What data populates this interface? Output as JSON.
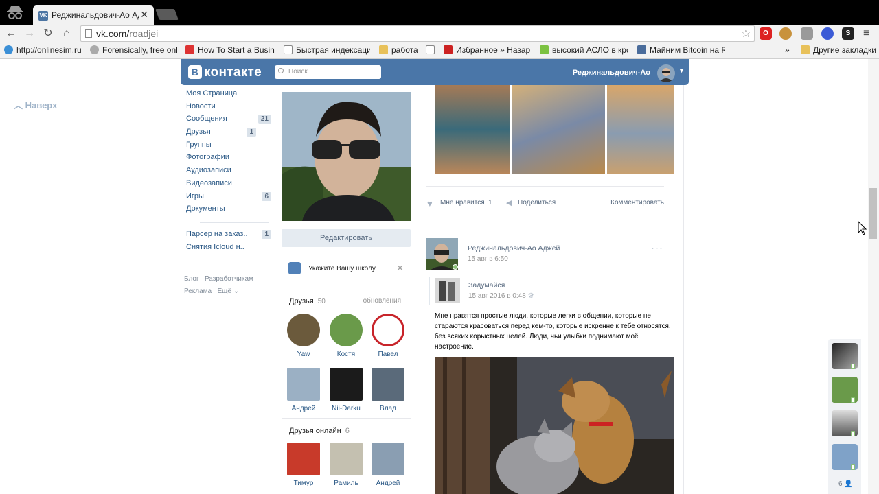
{
  "browser": {
    "tab_title": "Реджинальдович-Ао Ад",
    "tab_close": "✕",
    "url_domain": "vk.com/",
    "url_path": "roadjei",
    "bookmarks": [
      {
        "label": "http://onlinesim.ru",
        "icon": "onlinesim-icon"
      },
      {
        "label": "Forensically, free onlir",
        "icon": "magnifier-icon"
      },
      {
        "label": "How To Start a Busine",
        "icon": "ship-icon"
      },
      {
        "label": "Быстрая индексация",
        "icon": "page-icon"
      },
      {
        "label": "работа",
        "icon": "folder-icon"
      },
      {
        "label": "",
        "icon": "page-icon"
      },
      {
        "label": "Избранное » Назар Т",
        "icon": "flag-icon"
      },
      {
        "label": "высокий АСЛО в крс",
        "icon": "p-icon"
      },
      {
        "label": "Майним Bitcoin на Rt",
        "icon": "h-icon"
      }
    ],
    "bookmarks_more": "»",
    "other_bookmarks": "Другие закладки"
  },
  "vk": {
    "logo_text": "контакте",
    "logo_letter": "В",
    "search_placeholder": "Поиск",
    "header_user": "Реджинальдович-Ао",
    "back_to_top": "Наверх",
    "nav": [
      {
        "label": "Моя Страница",
        "count": ""
      },
      {
        "label": "Новости",
        "count": ""
      },
      {
        "label": "Сообщения",
        "count": "21"
      },
      {
        "label": "Друзья",
        "count": "1"
      },
      {
        "label": "Группы",
        "count": ""
      },
      {
        "label": "Фотографии",
        "count": ""
      },
      {
        "label": "Аудиозаписи",
        "count": ""
      },
      {
        "label": "Видеозаписи",
        "count": ""
      },
      {
        "label": "Игры",
        "count": "6"
      },
      {
        "label": "Документы",
        "count": ""
      }
    ],
    "nav_extra": [
      {
        "label": "Парсер на заказ..",
        "count": "1"
      },
      {
        "label": "Снятия Icloud н..",
        "count": ""
      }
    ],
    "footer": {
      "blog": "Блог",
      "dev": "Разработчикам",
      "ads": "Реклама",
      "more": "Ещё"
    },
    "edit_button": "Редактировать",
    "school_prompt": "Укажите Вашу школу",
    "friends": {
      "label": "Друзья",
      "count": "50",
      "updates": "обновления",
      "items": [
        "Yaw",
        "Костя",
        "Павел",
        "Андрей",
        "Nii-Darku",
        "Влад"
      ]
    },
    "friends_online": {
      "label": "Друзья онлайн",
      "count": "6",
      "items": [
        "Тимур",
        "Рамиль",
        "Андрей"
      ]
    },
    "post_actions": {
      "like": "Мне нравится",
      "like_count": "1",
      "share": "Поделиться",
      "comment": "Комментировать"
    },
    "post": {
      "author": "Реджинальдович-Ао Аджей",
      "date": "15 авг в 6:50",
      "repost_author": "Задумайся",
      "repost_date": "15 авг 2016 в 0:48",
      "text": "Мне нравятся простые люди, которые легки в общении, которые не стараются красоваться перед кем-то, которые искренне к тебе относятся, без всяких корыстных целей. Люди, чьи улыбки поднимают моё настроение."
    },
    "chat_online_count": "6"
  },
  "colors": {
    "vk_blue": "#4a76a8",
    "link": "#2a5885",
    "muted": "#939393"
  }
}
